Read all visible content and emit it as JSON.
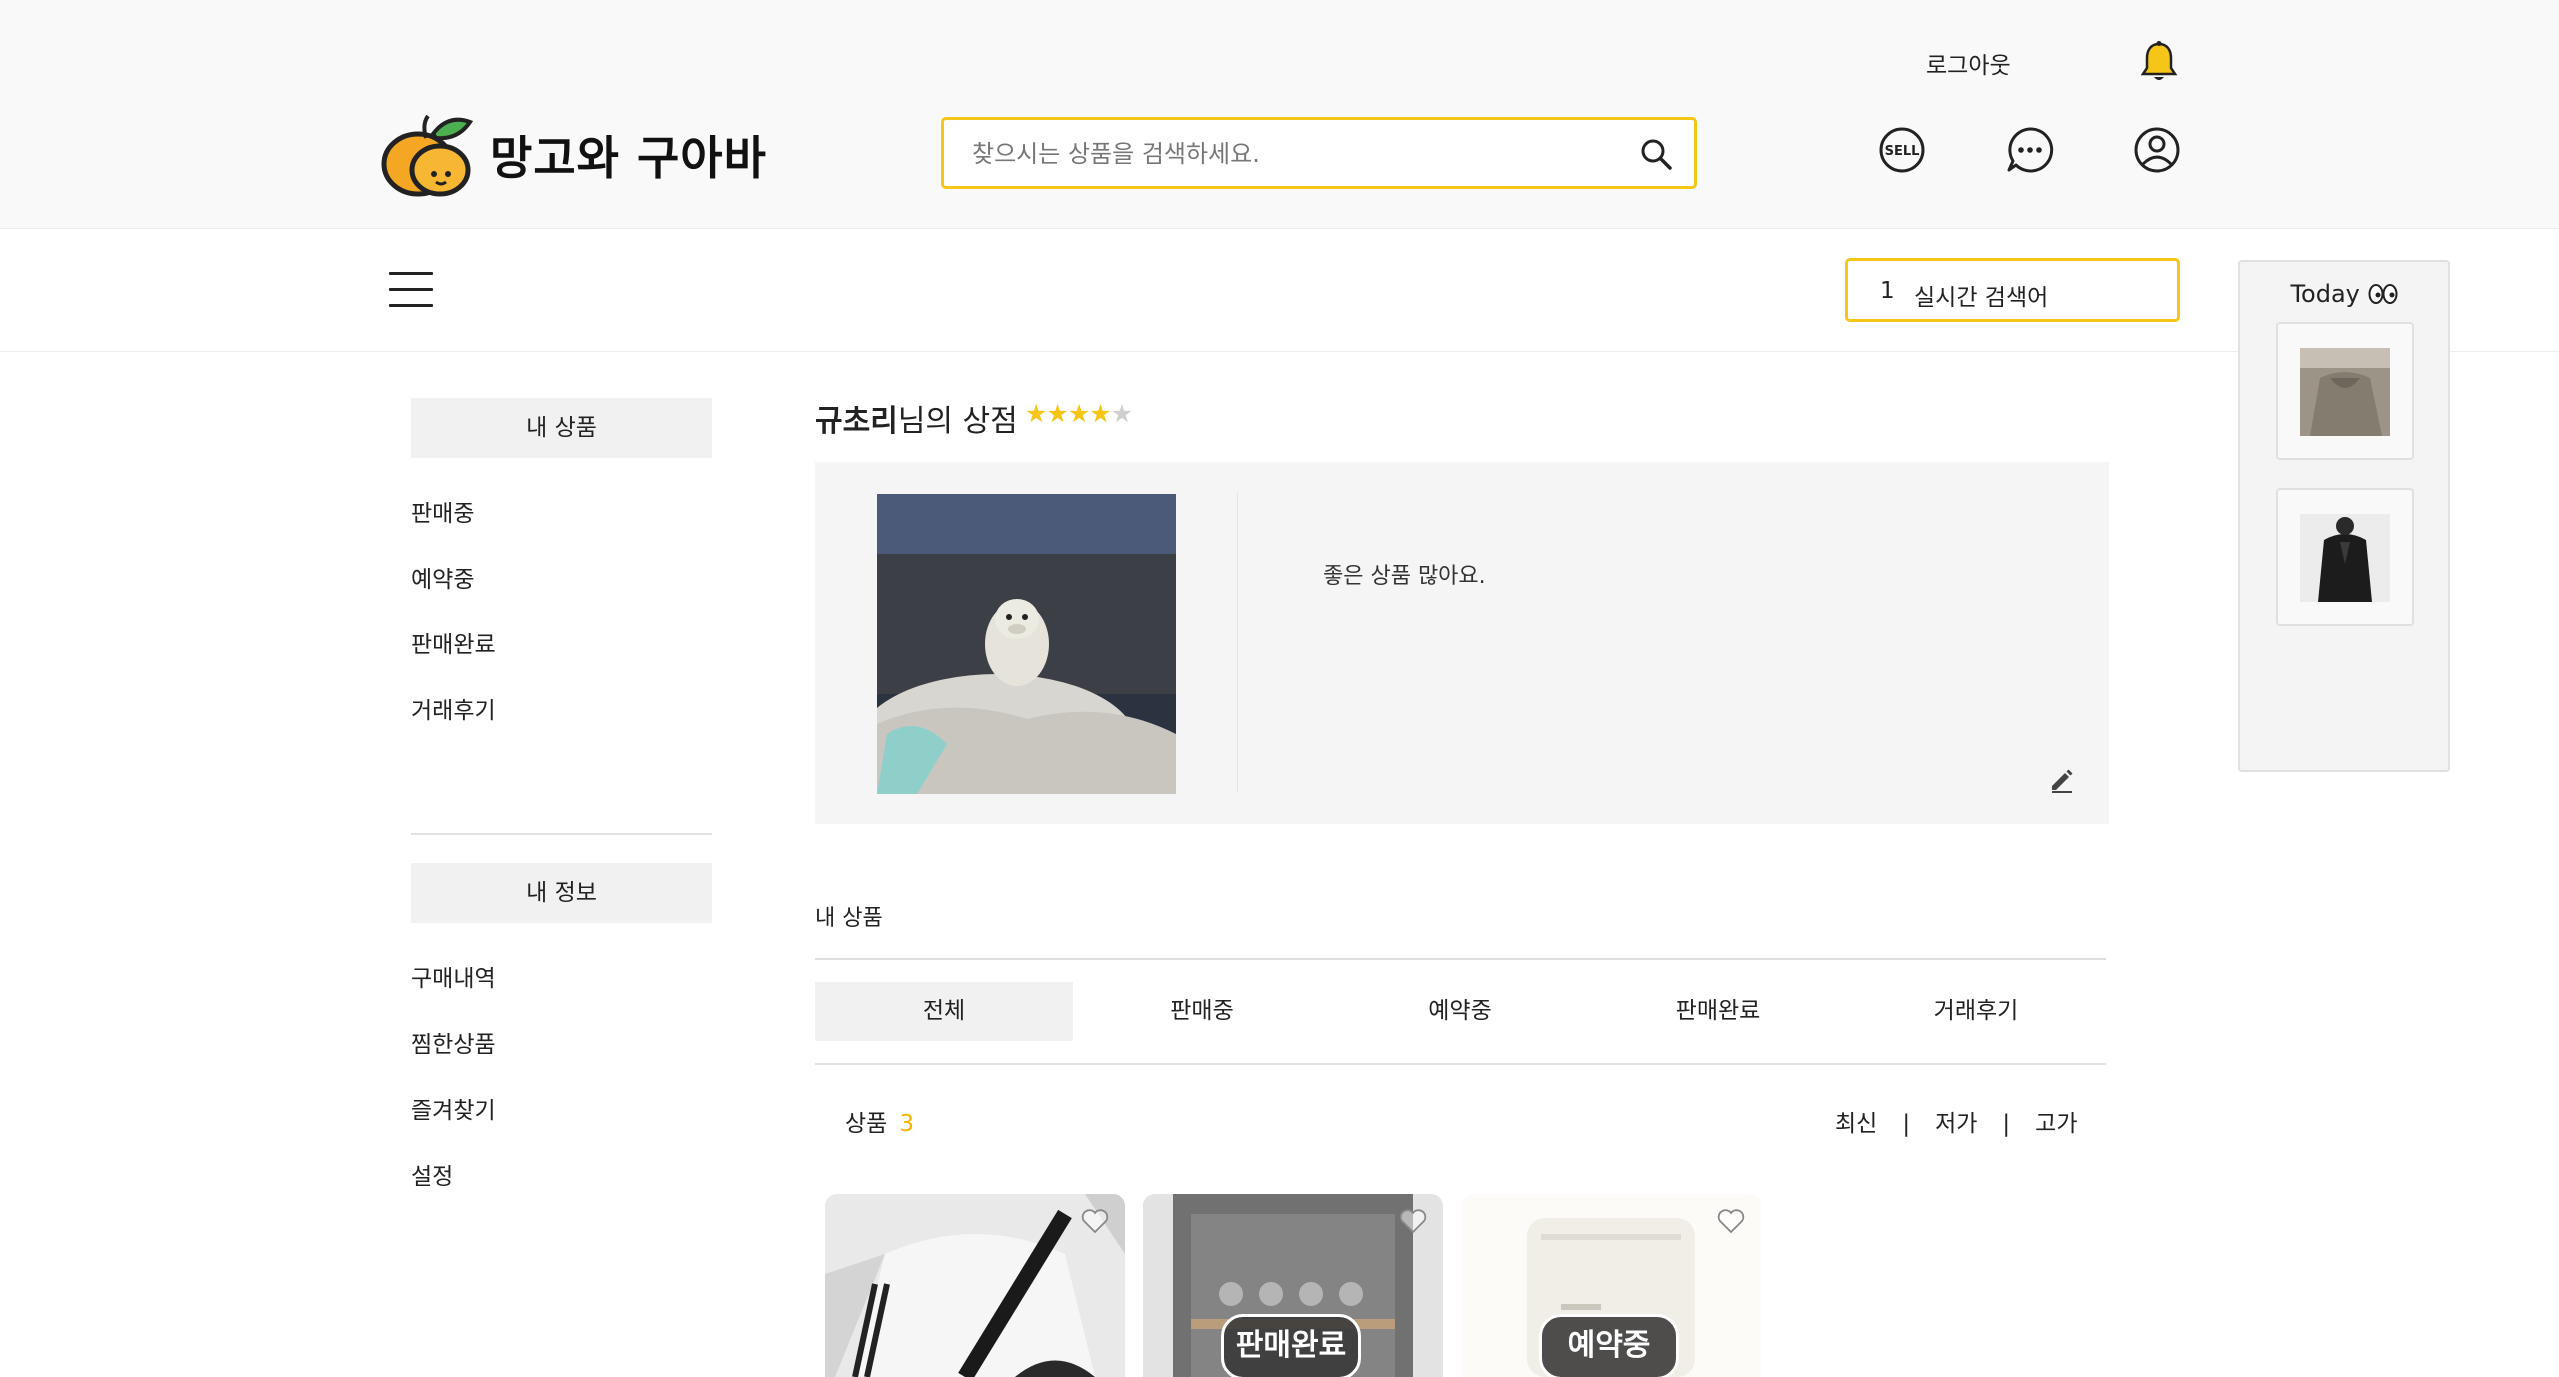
{
  "header": {
    "logo_text": "망고와 구아바",
    "logout_label": "로그아웃",
    "search_placeholder": "찾으시는 상품을 검색하세요.",
    "icons": [
      "bell-icon",
      "sell-icon",
      "chat-icon",
      "user-icon"
    ],
    "sell_icon_text": "SELL"
  },
  "nav": {
    "realtime_rank": "1",
    "realtime_label": "실시간 검색어"
  },
  "today": {
    "title": "Today",
    "items": [
      "recent-item-1",
      "recent-item-2"
    ]
  },
  "sidebar": {
    "products_heading": "내 상품",
    "product_links": [
      "판매중",
      "예약중",
      "판매완료",
      "거래후기"
    ],
    "info_heading": "내 정보",
    "info_links": [
      "구매내역",
      "찜한상품",
      "즐겨찾기",
      "설정"
    ]
  },
  "shop": {
    "owner": "규초리",
    "title_suffix": "님의 상점",
    "rating": 4,
    "max_rating": 5,
    "intro": "좋은 상품 많아요."
  },
  "products": {
    "section_label": "내 상품",
    "tabs": [
      "전체",
      "판매중",
      "예약중",
      "판매완료",
      "거래후기"
    ],
    "active_tab": 0,
    "count_label": "상품",
    "count": "3",
    "sort_options": [
      "최신",
      "저가",
      "고가"
    ],
    "sort_separator": "|",
    "items": [
      {
        "status": ""
      },
      {
        "status": "판매완료"
      },
      {
        "status": "예약중"
      }
    ]
  },
  "colors": {
    "accent": "#f5c518",
    "count_color": "#f5b400",
    "header_bg": "#f9f9f9"
  }
}
